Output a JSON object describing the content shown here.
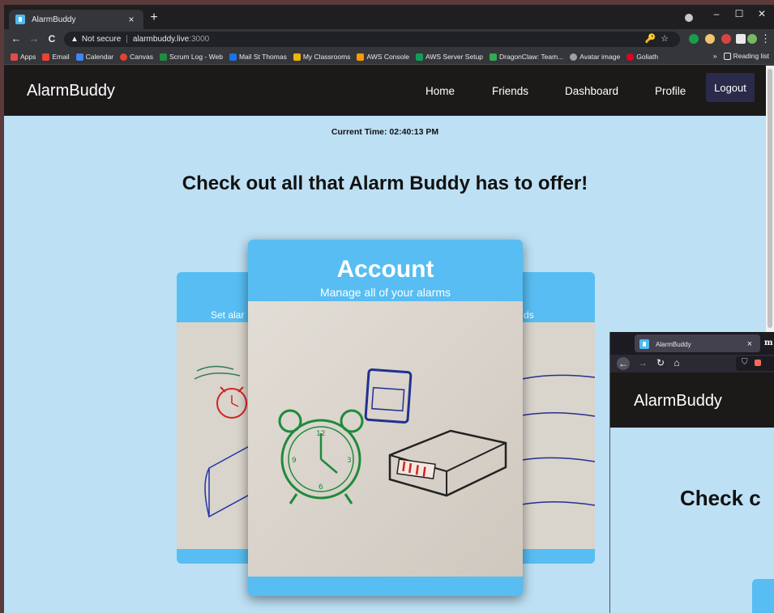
{
  "browser": {
    "tab_title": "AlarmBuddy",
    "new_tab": "+",
    "tab_close": "×",
    "window_controls": [
      "–",
      "☐",
      "✕"
    ],
    "nav": {
      "back": "←",
      "forward": "→",
      "reload": "C"
    },
    "omnibox": {
      "warning_icon": "▲",
      "security_label": "Not secure",
      "separator": "|",
      "host": "alarmbuddy.live",
      "port": ":3000",
      "right_icons": "🔑☆"
    },
    "menu": "⋮",
    "bookmarks": [
      {
        "label": "Apps",
        "color": "#e04b4b"
      },
      {
        "label": "Email",
        "color": "#ea4335"
      },
      {
        "label": "Calendar",
        "color": "#4285f4"
      },
      {
        "label": "Canvas",
        "color": "#e34234"
      },
      {
        "label": "Scrum Log - Web",
        "color": "#1e8e3e"
      },
      {
        "label": "Mail St Thomas",
        "color": "#1a73e8"
      },
      {
        "label": "My Classrooms",
        "color": "#f4b400"
      },
      {
        "label": "AWS Console",
        "color": "#ff9900"
      },
      {
        "label": "AWS Server Setup",
        "color": "#0f9d58"
      },
      {
        "label": "DragonClaw: Team...",
        "color": "#34a853"
      },
      {
        "label": "Avatar image",
        "color": "#9aa0a6"
      },
      {
        "label": "Goliath",
        "color": "#e60023"
      }
    ],
    "bookmarks_more": "»",
    "reading_list": "Reading list"
  },
  "app": {
    "brand": "AlarmBuddy",
    "nav_links": [
      "Home",
      "Friends",
      "Dashboard",
      "Profile"
    ],
    "logout": "Logout",
    "current_time": "Current Time: 02:40:13 PM",
    "headline": "Check out all that Alarm Buddy has to offer!",
    "carousel": {
      "active": {
        "title": "Account",
        "subtitle": "Manage all of your alarms"
      },
      "left_subtitle_visible": "Set alar",
      "right_subtitle_visible": "ds"
    }
  },
  "overlay_window": {
    "tab_title": "AlarmBuddy",
    "tab_close": "×",
    "next_tab_letter": "m",
    "brand": "AlarmBuddy",
    "headline_visible": "Check c"
  },
  "colors": {
    "page_bg": "#bde0f4",
    "navbar": "#1c1919",
    "card_blue": "#57bdf2",
    "logout_bg": "#2a2a4a"
  }
}
